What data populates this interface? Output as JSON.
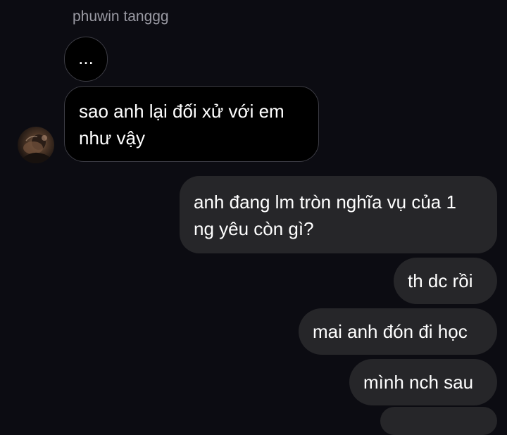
{
  "conversation": {
    "sender_name": "phuwin tanggg",
    "messages": [
      {
        "direction": "incoming",
        "text": "...",
        "kind": "typing"
      },
      {
        "direction": "incoming",
        "lines": [
          "sao anh lại đối xử với em",
          "như vậy"
        ]
      },
      {
        "direction": "outgoing",
        "lines": [
          "anh đang lm tròn nghĩa vụ của 1",
          "ng yêu còn gì?"
        ]
      },
      {
        "direction": "outgoing",
        "text": "th dc rồi"
      },
      {
        "direction": "outgoing",
        "text": "mai anh đón đi học"
      },
      {
        "direction": "outgoing",
        "text": "mình nch sau"
      }
    ]
  },
  "colors": {
    "background": "#0c0c12",
    "incoming_bubble": "#000000",
    "incoming_border": "#3c3c44",
    "outgoing_bubble": "#262629",
    "sender_name": "#9a9aa3",
    "text": "#ffffff"
  },
  "icons": {
    "avatar": "sender-avatar-photo"
  }
}
